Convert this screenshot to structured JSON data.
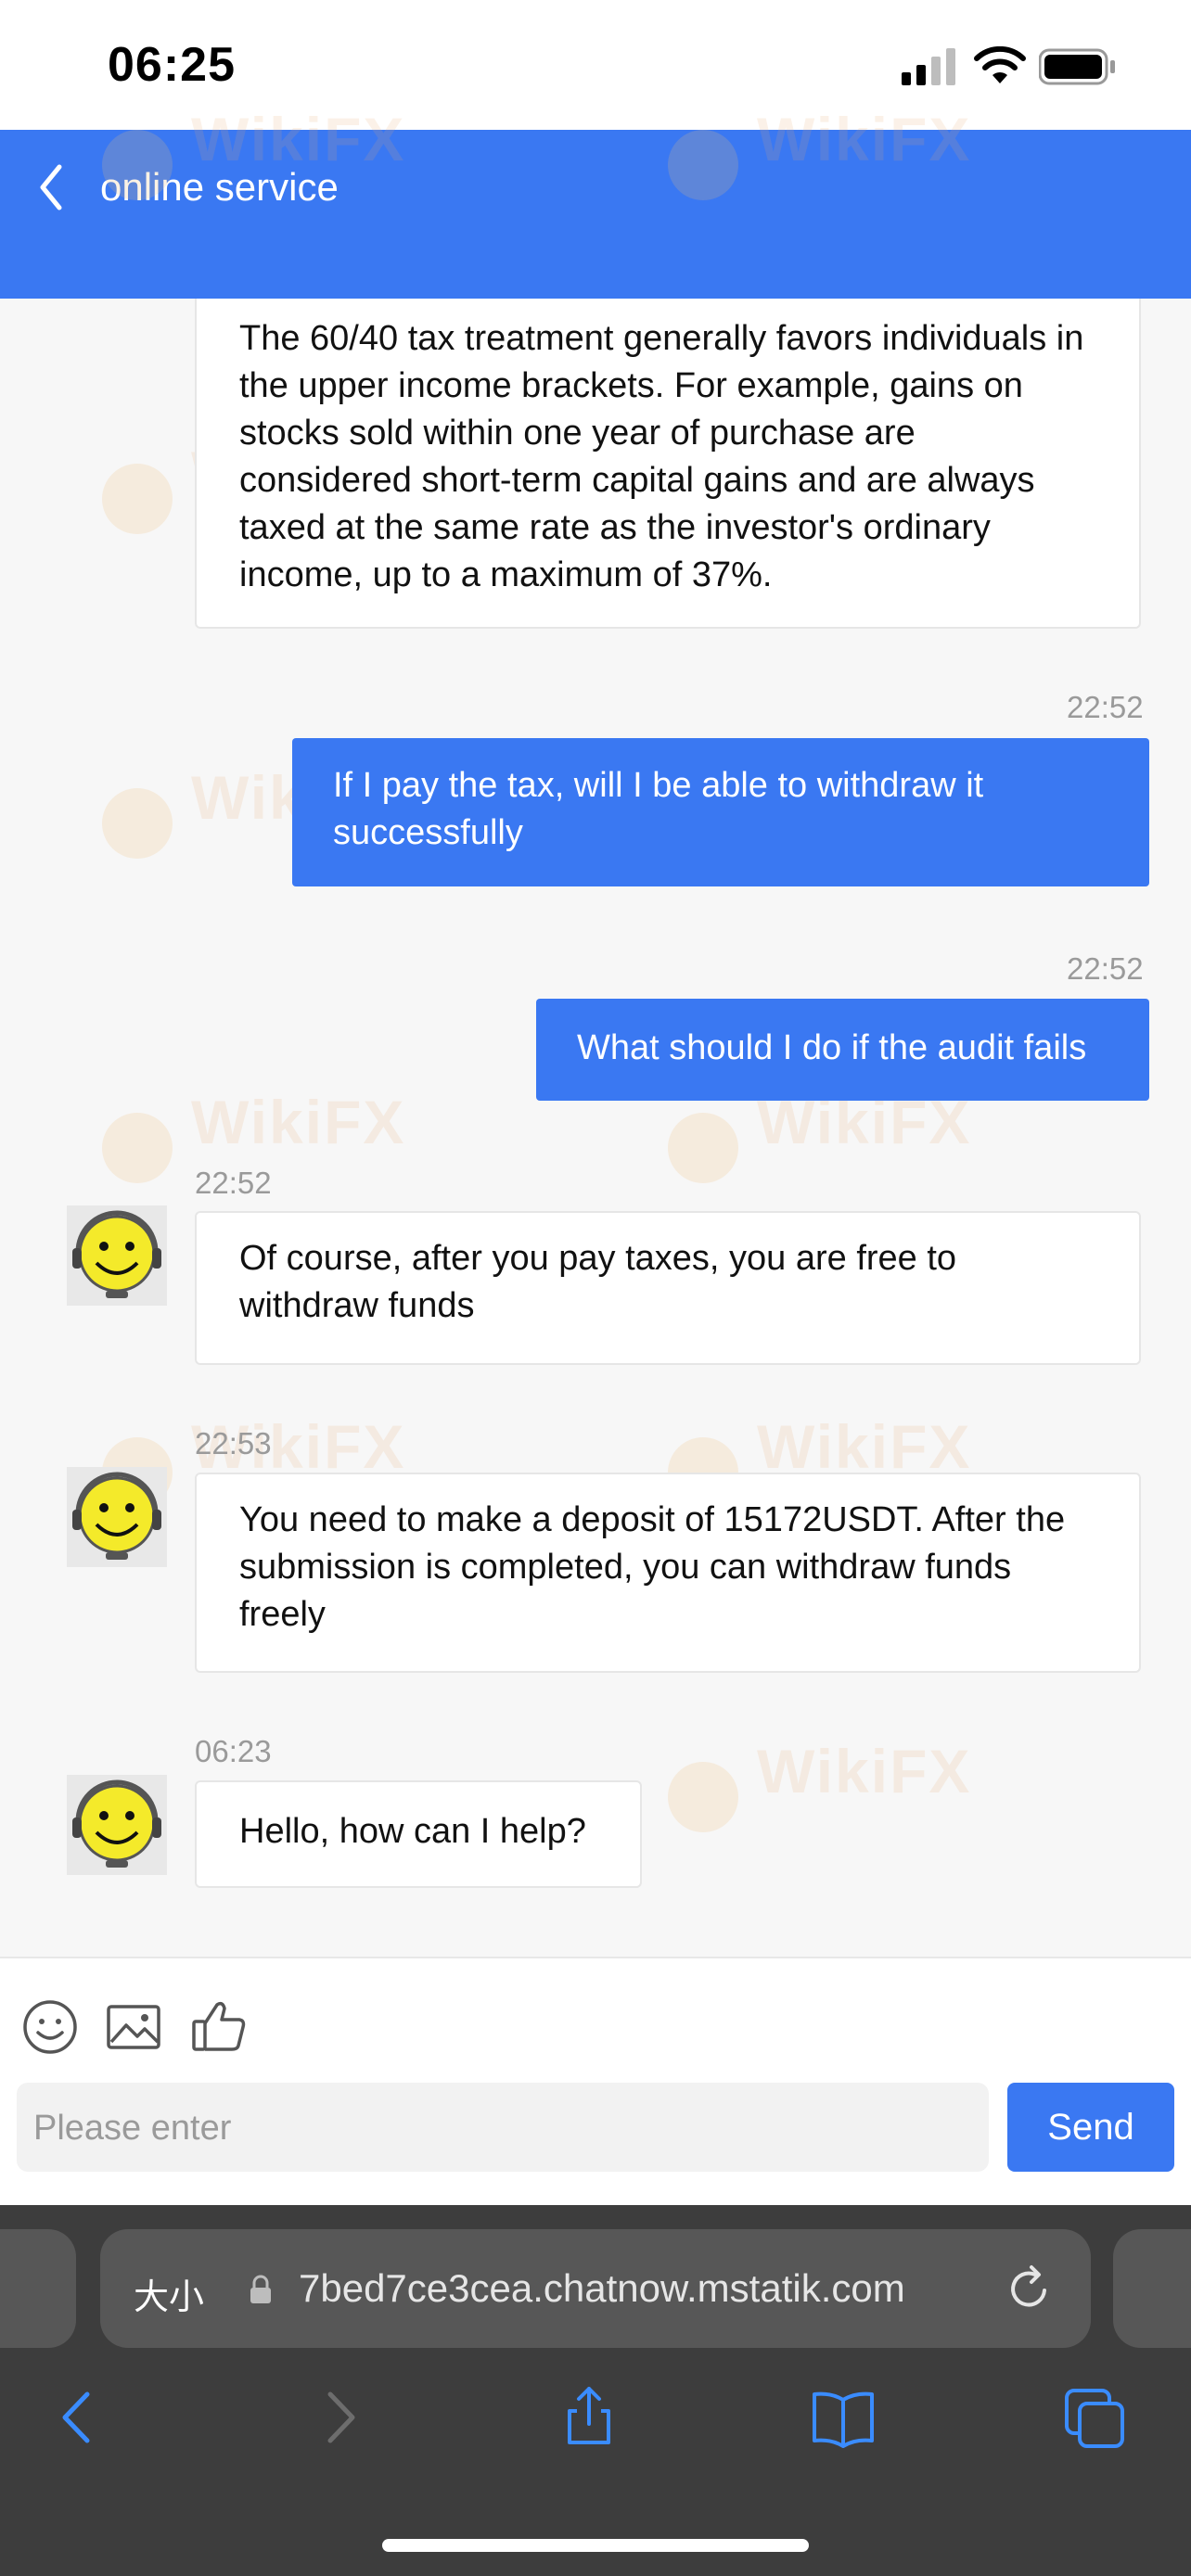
{
  "status_bar": {
    "time": "06:25"
  },
  "header": {
    "title": "online service"
  },
  "messages": [
    {
      "from": "agent",
      "text": "The 60/40 tax treatment generally favors individuals in the upper income brackets. For example, gains on stocks sold within one year of purchase are considered short-term capital gains and are always taxed at the same rate as the investor's ordinary income, up to a maximum of 37%."
    },
    {
      "from": "user",
      "time": "22:52",
      "text": "If I pay the tax, will I be able to withdraw it successfully"
    },
    {
      "from": "user",
      "time": "22:52",
      "text": "What should I do if the audit fails"
    },
    {
      "from": "agent",
      "time": "22:52",
      "text": "Of course, after you pay taxes, you are free to withdraw funds"
    },
    {
      "from": "agent",
      "time": "22:53",
      "text": "You need to make a deposit of 15172USDT. After the submission is completed, you can withdraw funds freely"
    },
    {
      "from": "agent",
      "time": "06:23",
      "text": "Hello, how can I help?"
    }
  ],
  "input": {
    "placeholder": "Please enter",
    "send_label": "Send"
  },
  "browser": {
    "text_size_label": "大小",
    "url": "7bed7ce3cea.chatnow.mstatik.com"
  },
  "watermark": "WikiFX",
  "colors": {
    "accent": "#3a78f2",
    "header": "#3a78f2",
    "browser_bar": "#3d3d3d"
  },
  "icons": [
    "signal-icon",
    "wifi-icon",
    "battery-icon",
    "back-icon",
    "emoji-icon",
    "image-icon",
    "thumbs-up-icon",
    "lock-icon",
    "reload-icon",
    "browser-back-icon",
    "browser-forward-icon",
    "share-icon",
    "bookmarks-icon",
    "tabs-icon"
  ]
}
